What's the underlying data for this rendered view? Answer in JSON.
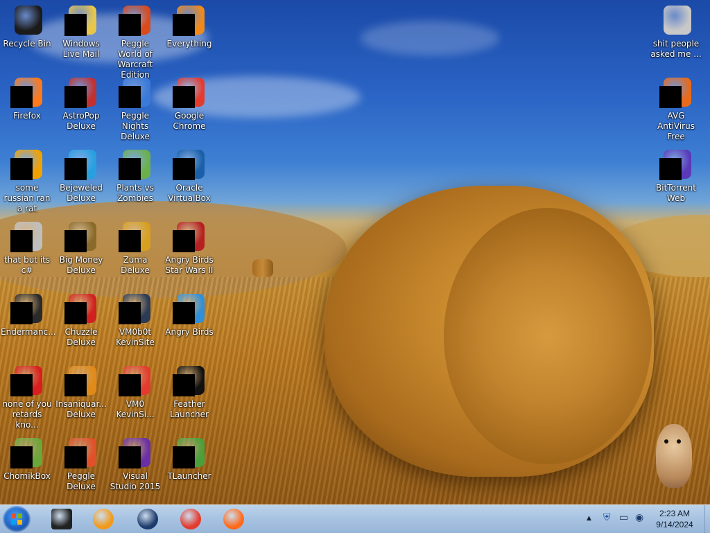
{
  "desktop": {
    "icons": [
      {
        "label": "Recycle Bin",
        "color": "#1b1b1b",
        "redacted": false
      },
      {
        "label": "Windows Live Mail",
        "color": "#e8c64a",
        "redacted": true
      },
      {
        "label": "Peggle World of Warcraft Edition",
        "color": "#d94a1c",
        "redacted": true
      },
      {
        "label": "Everything",
        "color": "#f08a1a",
        "redacted": true
      },
      {
        "label": "Firefox",
        "color": "#ff7a1a",
        "redacted": true
      },
      {
        "label": "AstroPop Deluxe",
        "color": "#c23030",
        "redacted": true
      },
      {
        "label": "Peggle Nights Deluxe",
        "color": "#3a7ad8",
        "redacted": true
      },
      {
        "label": "Google Chrome",
        "color": "#e33b2e",
        "redacted": true
      },
      {
        "label": "some russian ran a rat",
        "color": "#f2a200",
        "redacted": true
      },
      {
        "label": "Bejeweled Deluxe",
        "color": "#28a0e0",
        "redacted": true
      },
      {
        "label": "Plants vs Zombies",
        "color": "#6bb04a",
        "redacted": true
      },
      {
        "label": "Oracle VirtualBox",
        "color": "#1a5fa8",
        "redacted": true
      },
      {
        "label": "that but its c#",
        "color": "#bfbfbf",
        "redacted": true
      },
      {
        "label": "Big Money Deluxe",
        "color": "#8a6a2a",
        "redacted": true
      },
      {
        "label": "Zuma Deluxe",
        "color": "#d8a020",
        "redacted": true
      },
      {
        "label": "Angry Birds Star Wars II",
        "color": "#b52020",
        "redacted": true
      },
      {
        "label": "Endermanc...",
        "color": "#2a2a2a",
        "redacted": true
      },
      {
        "label": "Chuzzle Deluxe",
        "color": "#d02020",
        "redacted": true
      },
      {
        "label": "VM0b0t KevinSite",
        "color": "#2b3a55",
        "redacted": true
      },
      {
        "label": "Angry Birds",
        "color": "#2f8fd8",
        "redacted": true
      },
      {
        "label": "none of you retards kno...",
        "color": "#d81e1e",
        "redacted": true
      },
      {
        "label": "Insaniquar... Deluxe",
        "color": "#e08a1a",
        "redacted": true
      },
      {
        "label": "VM0 KevinSi...",
        "color": "#e33b2e",
        "redacted": true
      },
      {
        "label": "Feather Launcher",
        "color": "#111111",
        "redacted": true
      },
      {
        "label": "ChomikBox",
        "color": "#6aa83a",
        "redacted": true
      },
      {
        "label": "Peggle Deluxe",
        "color": "#e0502a",
        "redacted": true
      },
      {
        "label": "Visual Studio 2015",
        "color": "#6a2fa8",
        "redacted": true
      },
      {
        "label": "TLauncher",
        "color": "#4aa03a",
        "redacted": true
      },
      {
        "label": "shit people asked me ...",
        "color": "#c8c8c8",
        "redacted": false
      },
      {
        "label": "AVG AntiVirus Free",
        "color": "#e86a1a",
        "redacted": true
      },
      {
        "label": "BitTorrent Web",
        "color": "#5a3ab8",
        "redacted": true
      }
    ]
  },
  "taskbar": {
    "pinned": [
      {
        "name": "mail-app",
        "color": "#222222"
      },
      {
        "name": "media-player",
        "color": "#f29a1a"
      },
      {
        "name": "globe-app",
        "color": "#1d3b6b"
      },
      {
        "name": "chrome",
        "color": "#e33b2e"
      },
      {
        "name": "firefox",
        "color": "#ff6a1a"
      }
    ],
    "tray": {
      "expand_glyph": "▲",
      "shield_glyph": "⛨",
      "monitor_glyph": "▭",
      "volume_glyph": "◉"
    },
    "clock": {
      "time": "2:23 AM",
      "date": "9/14/2024"
    }
  }
}
